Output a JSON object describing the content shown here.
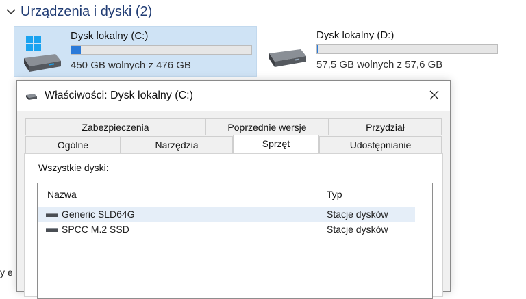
{
  "explorer": {
    "section_title": "Urządzenia i dyski (2)",
    "stray_text": "y e",
    "drives": [
      {
        "name": "Dysk lokalny (C:)",
        "free_text": "450 GB wolnych z 476 GB",
        "used_fraction": 0.055,
        "icon": "windows-drive-icon"
      },
      {
        "name": "Dysk lokalny (D:)",
        "free_text": "57,5 GB wolnych z 57,6 GB",
        "used_fraction": 0.002,
        "icon": "hard-drive-icon"
      }
    ]
  },
  "dialog": {
    "title": "Właściwości: Dysk lokalny (C:)",
    "close_icon": "close-icon",
    "tabs_back": [
      "Zabezpieczenia",
      "Poprzednie wersje",
      "Przydział"
    ],
    "tabs_front": [
      "Ogólne",
      "Narzędzia",
      "Sprzęt",
      "Udostępnianie"
    ],
    "active_tab": "Sprzęt",
    "all_disks_label": "Wszystkie dyski:",
    "columns": {
      "name": "Nazwa",
      "type": "Typ"
    },
    "disks": [
      {
        "name": "Generic SLD64G",
        "type": "Stacje dysków",
        "selected": true
      },
      {
        "name": "SPCC M.2 SSD",
        "type": "Stacje dysków",
        "selected": false
      }
    ]
  },
  "colors": {
    "accent": "#2a7ad9",
    "selection": "#cfe3f5",
    "section_title": "#1f3b73"
  }
}
